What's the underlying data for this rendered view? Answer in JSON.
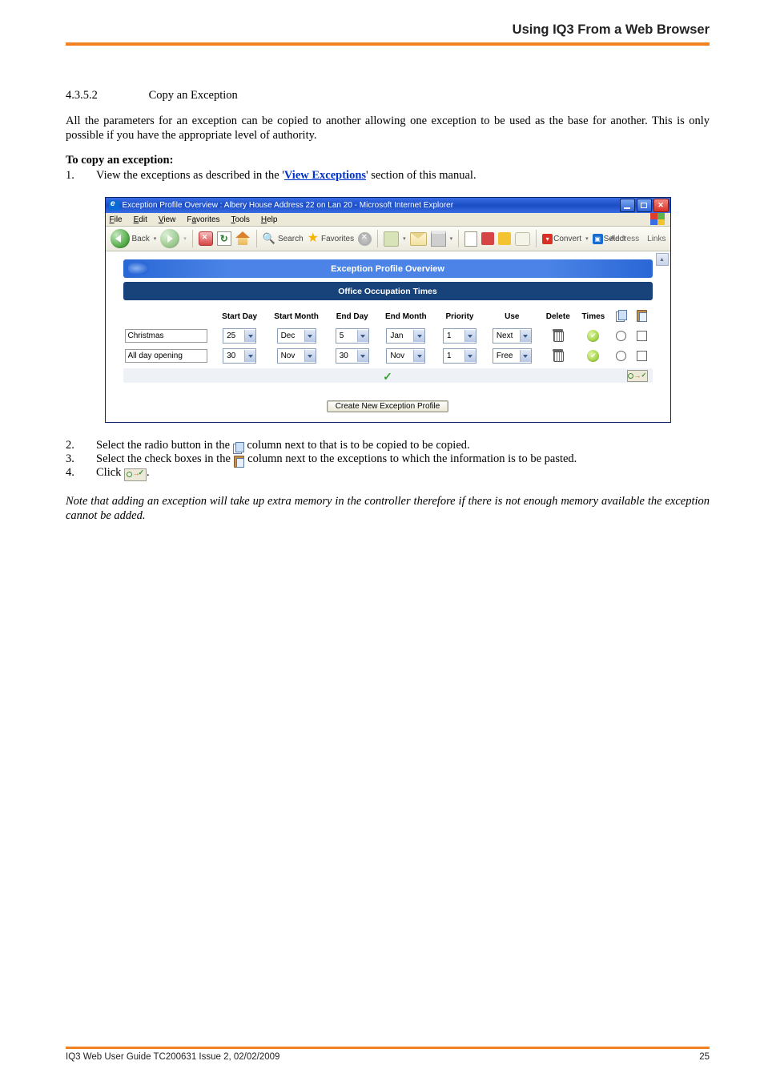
{
  "header": {
    "title": "Using IQ3 From a Web Browser"
  },
  "section": {
    "number": "4.3.5.2",
    "title": "Copy an Exception"
  },
  "para1": "All the parameters for an exception can be copied to another allowing one exception to be used as the base for another. This is only possible if you have the appropriate level of authority.",
  "heading2": "To copy an exception:",
  "step1_pre": "View the exceptions as described in the '",
  "step1_link": "View Exceptions",
  "step1_post": "' section of this manual.",
  "step2_pre": "Select the radio button in the ",
  "step2_post": " column next to that is to be copied to be copied.",
  "step3_pre": "Select the check boxes in the ",
  "step3_post": " column next to the exceptions to which the information is to be pasted.",
  "step4_pre": "Click ",
  "step4_post": ".",
  "note": "Note that adding an exception will take up extra memory in the controller therefore if there is not enough memory available the exception cannot be added.",
  "ie": {
    "title": "Exception Profile Overview : Albery House Address 22 on Lan 20 - Microsoft Internet Explorer",
    "menu": {
      "file": "File",
      "edit": "Edit",
      "view": "View",
      "favorites": "Favorites",
      "tools": "Tools",
      "help": "Help"
    },
    "toolbar": {
      "back": "Back",
      "search": "Search",
      "favorites": "Favorites",
      "convert": "Convert",
      "select": "Select",
      "address": "Address",
      "links": "Links"
    },
    "band_title": "Exception Profile Overview",
    "sub_title": "Office Occupation Times",
    "cols": {
      "c1": "Start Day",
      "c2": "Start Month",
      "c3": "End Day",
      "c4": "End Month",
      "c5": "Priority",
      "c6": "Use",
      "c7": "Delete",
      "c8": "Times"
    },
    "rows": [
      {
        "name": "Christmas",
        "sd": "25",
        "sm": "Dec",
        "ed": "5",
        "em": "Jan",
        "pr": "1",
        "use": "Next"
      },
      {
        "name": "All day opening",
        "sd": "30",
        "sm": "Nov",
        "ed": "30",
        "em": "Nov",
        "pr": "1",
        "use": "Free"
      }
    ],
    "button": "Create New Exception Profile"
  },
  "footer": {
    "left": "IQ3 Web User Guide TC200631 Issue 2, 02/02/2009",
    "right": "25"
  }
}
